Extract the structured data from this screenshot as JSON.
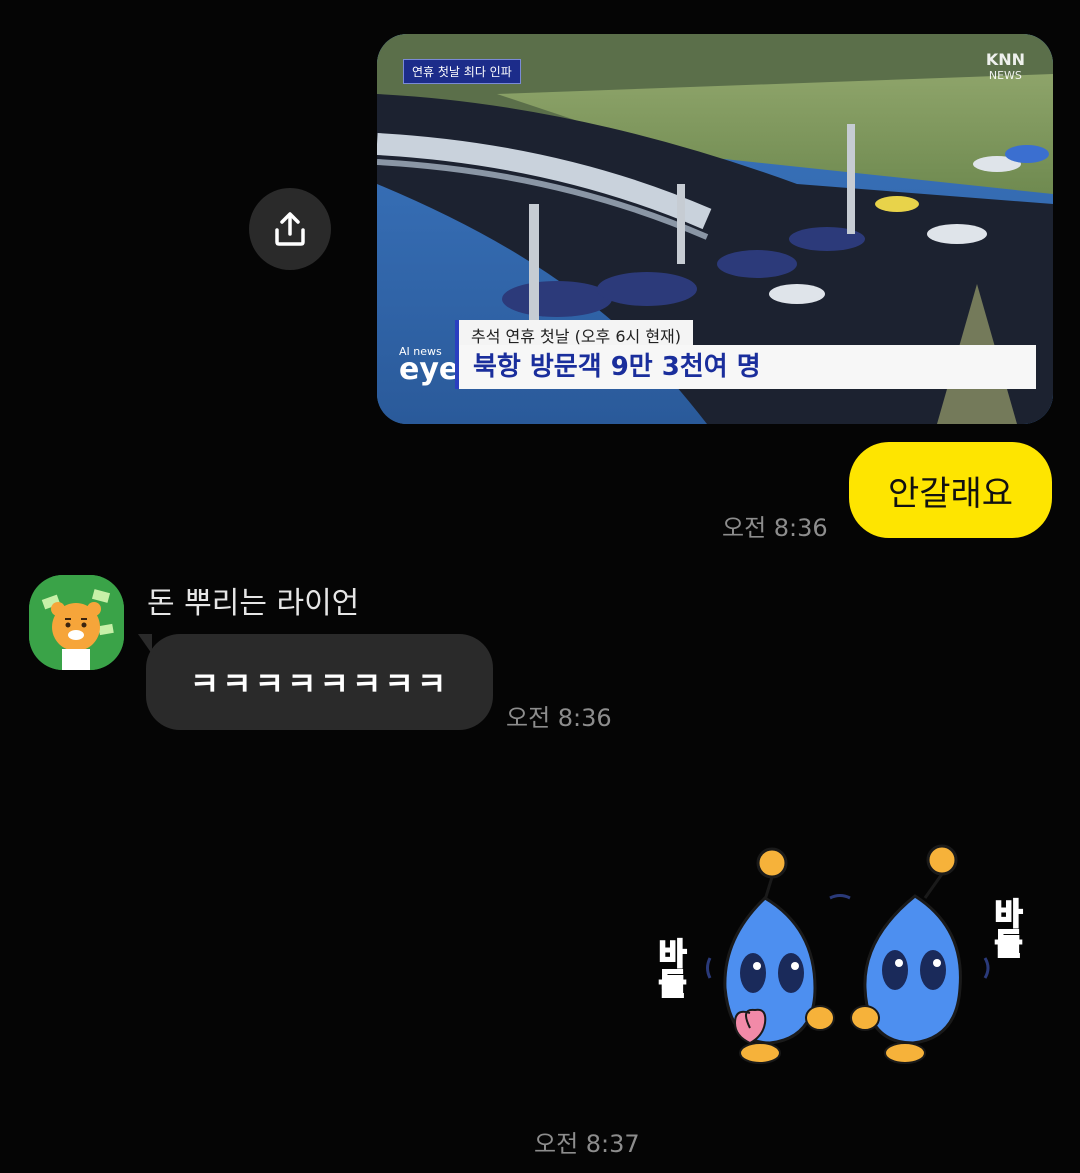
{
  "message_photo": {
    "news_tag": "연휴 첫날 최다 인파",
    "broadcaster": "KNN",
    "broadcaster_sub": "NEWS",
    "program_logo_top": "AI news",
    "program_logo_main": "eye",
    "caption_sub": "추석 연휴 첫날 (오후 6시 현재)",
    "caption_main": "북항 방문객 9만 3천여 명"
  },
  "my_message": {
    "text": "안갈래요",
    "time": "오전 8:36"
  },
  "other_message": {
    "sender": "돈 뿌리는 라이언",
    "text": "ㅋㅋㅋㅋㅋㅋㅋㅋ",
    "time": "오전 8:36"
  },
  "sticker_message": {
    "sticker_text_left": "바들",
    "sticker_text_right": "바들",
    "time": "오전 8:37"
  },
  "icons": {
    "share": "share-upload-icon"
  },
  "colors": {
    "background": "#050505",
    "my_bubble": "#fee500",
    "other_bubble": "#2a2a2a",
    "timestamp": "#8d8d8d"
  }
}
